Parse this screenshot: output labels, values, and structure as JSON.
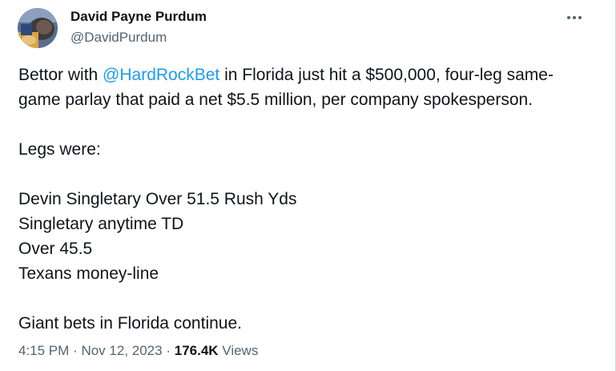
{
  "author": {
    "display_name": "David Payne Purdum",
    "handle": "@DavidPurdum"
  },
  "more_icon": "ellipsis-icon",
  "colors": {
    "mention": "#1d9bf0",
    "secondary_text": "#536471",
    "primary_text": "#0f1419"
  },
  "tweet": {
    "line1_prefix": "Bettor with ",
    "mention": "@HardRockBet",
    "line1_suffix": " in Florida just hit a $500,000, four-leg same-",
    "line2": "game parlay that paid a net $5.5 million, per company spokesperson.",
    "legs_heading": "Legs were:",
    "legs": [
      "Devin Singletary Over 51.5 Rush Yds",
      "Singletary anytime TD",
      "Over 45.5",
      "Texans money-line"
    ],
    "closing": "Giant bets in Florida continue."
  },
  "meta": {
    "time": "4:15 PM",
    "separator": "·",
    "date": "Nov 12, 2023",
    "views_count": "176.4K",
    "views_label": "Views"
  }
}
